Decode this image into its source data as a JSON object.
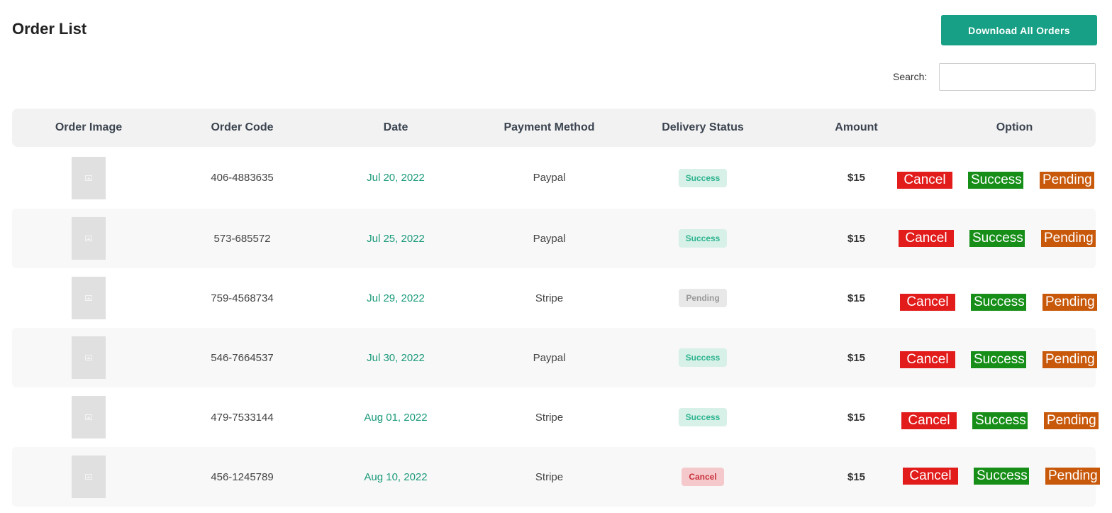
{
  "header": {
    "title": "Order List",
    "download_label": "Download All Orders"
  },
  "search": {
    "label": "Search:",
    "value": "",
    "placeholder": ""
  },
  "table": {
    "columns": [
      "Order Image",
      "Order Code",
      "Date",
      "Payment Method",
      "Delivery Status",
      "Amount",
      "Option"
    ],
    "option_labels": {
      "cancel": "Cancel",
      "success": "Success",
      "pending": "Pending"
    },
    "rows": [
      {
        "code": "406-4883635",
        "date": "Jul 20, 2022",
        "payment": "Paypal",
        "status": "Success",
        "amount": "$15"
      },
      {
        "code": "573-685572",
        "date": "Jul 25, 2022",
        "payment": "Paypal",
        "status": "Success",
        "amount": "$15"
      },
      {
        "code": "759-4568734",
        "date": "Jul 29, 2022",
        "payment": "Stripe",
        "status": "Pending",
        "amount": "$15"
      },
      {
        "code": "546-7664537",
        "date": "Jul 30, 2022",
        "payment": "Paypal",
        "status": "Success",
        "amount": "$15"
      },
      {
        "code": "479-7533144",
        "date": "Aug 01, 2022",
        "payment": "Stripe",
        "status": "Success",
        "amount": "$15"
      },
      {
        "code": "456-1245789",
        "date": "Aug 10, 2022",
        "payment": "Stripe",
        "status": "Cancel",
        "amount": "$15"
      }
    ]
  },
  "colors": {
    "primary": "#17a085",
    "date_text": "#1a9a7a",
    "cancel_button": "#e21b1b",
    "success_button": "#168e18",
    "pending_button": "#c8580a"
  }
}
